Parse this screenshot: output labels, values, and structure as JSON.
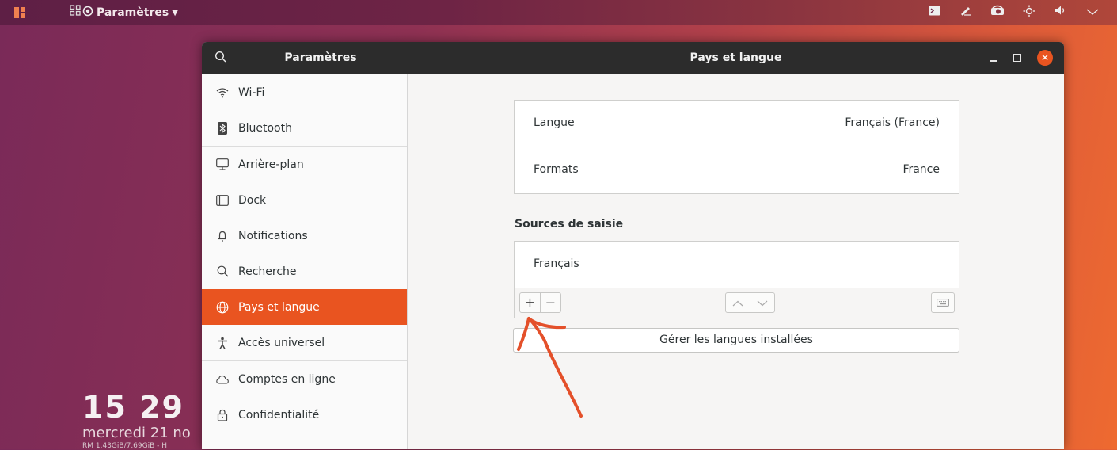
{
  "topbar": {
    "app_menu_label": "Paramètres",
    "app_menu_icon": "gear-icon",
    "tray_icons": [
      "terminal-icon",
      "pen-icon",
      "camera-icon",
      "brightness-icon",
      "volume-icon",
      "chevron-down-icon"
    ]
  },
  "desktop": {
    "clock": "15 29",
    "date": "mercredi 21 no",
    "meminfo": "RM 1.43GiB/7.69GiB - H"
  },
  "window": {
    "sidebar_title": "Paramètres",
    "page_title": "Pays et langue",
    "sidebar": {
      "items": [
        {
          "label": "Wi-Fi",
          "icon": "wifi-icon"
        },
        {
          "label": "Bluetooth",
          "icon": "bluetooth-icon"
        },
        {
          "label": "Arrière-plan",
          "icon": "background-icon"
        },
        {
          "label": "Dock",
          "icon": "dock-icon"
        },
        {
          "label": "Notifications",
          "icon": "bell-icon"
        },
        {
          "label": "Recherche",
          "icon": "search-icon"
        },
        {
          "label": "Pays et langue",
          "icon": "globe-icon",
          "active": true
        },
        {
          "label": "Accès universel",
          "icon": "accessibility-icon"
        },
        {
          "label": "Comptes en ligne",
          "icon": "cloud-icon"
        },
        {
          "label": "Confidentialité",
          "icon": "lock-icon"
        }
      ]
    },
    "main": {
      "language_label": "Langue",
      "language_value": "Français (France)",
      "formats_label": "Formats",
      "formats_value": "France",
      "input_sources_title": "Sources de saisie",
      "input_sources": [
        "Français"
      ],
      "add_label": "+",
      "remove_label": "−",
      "manage_languages_label": "Gérer les langues installées"
    }
  },
  "colors": {
    "accent": "#e95420",
    "annotation": "#e4502a"
  }
}
